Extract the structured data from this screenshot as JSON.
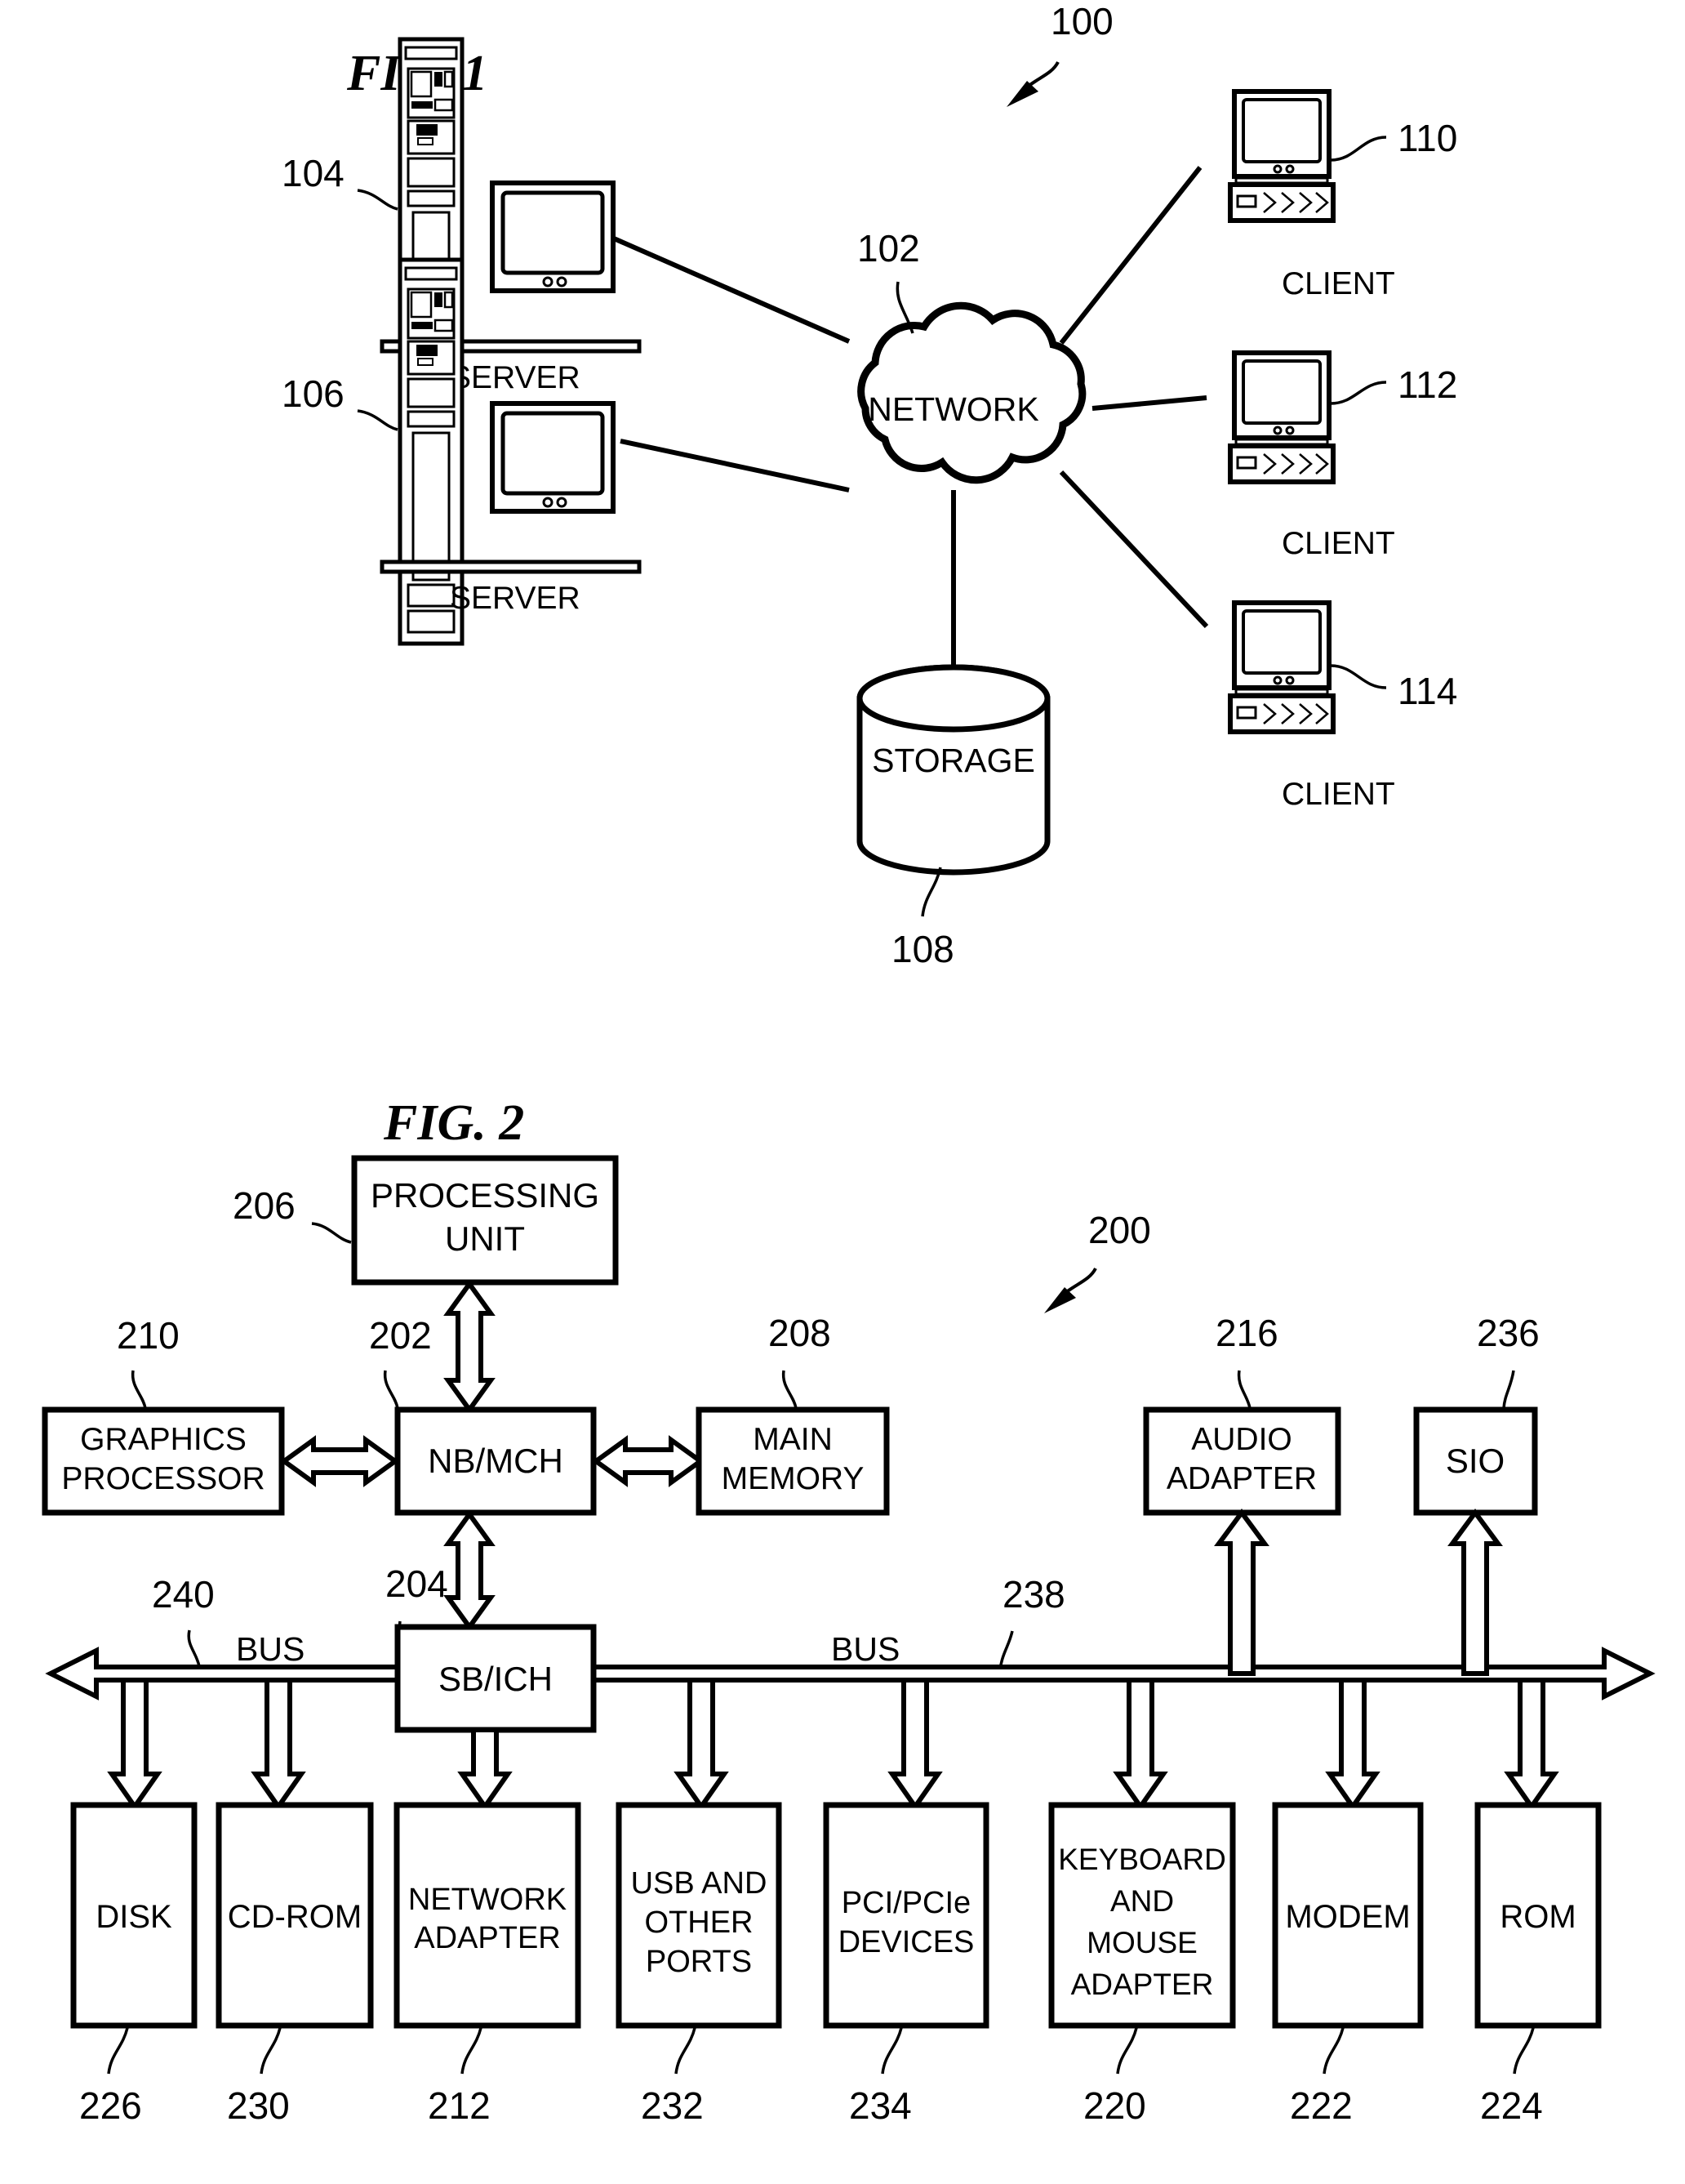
{
  "figures": [
    {
      "id": "fig1",
      "title": "FIG. 1",
      "overall_ref": "100",
      "nodes": [
        {
          "ref": "104",
          "label": "SERVER",
          "kind": "server"
        },
        {
          "ref": "106",
          "label": "SERVER",
          "kind": "server"
        },
        {
          "ref": "102",
          "label": "NETWORK",
          "kind": "cloud"
        },
        {
          "ref": "108",
          "label": "STORAGE",
          "kind": "cylinder"
        },
        {
          "ref": "110",
          "label": "CLIENT",
          "kind": "client"
        },
        {
          "ref": "112",
          "label": "CLIENT",
          "kind": "client"
        },
        {
          "ref": "114",
          "label": "CLIENT",
          "kind": "client"
        }
      ]
    },
    {
      "id": "fig2",
      "title": "FIG. 2",
      "overall_ref": "200",
      "nodes": [
        {
          "ref": "206",
          "label": "PROCESSING UNIT",
          "lines": [
            "PROCESSING",
            "UNIT"
          ]
        },
        {
          "ref": "210",
          "label": "GRAPHICS PROCESSOR",
          "lines": [
            "GRAPHICS",
            "PROCESSOR"
          ]
        },
        {
          "ref": "202",
          "label": "NB/MCH",
          "lines": [
            "NB/MCH"
          ]
        },
        {
          "ref": "208",
          "label": "MAIN MEMORY",
          "lines": [
            "MAIN",
            "MEMORY"
          ]
        },
        {
          "ref": "216",
          "label": "AUDIO ADAPTER",
          "lines": [
            "AUDIO",
            "ADAPTER"
          ]
        },
        {
          "ref": "236",
          "label": "SIO",
          "lines": [
            "SIO"
          ]
        },
        {
          "ref": "204",
          "label": "SB/ICH",
          "lines": [
            "SB/ICH"
          ]
        },
        {
          "ref": "226",
          "label": "DISK",
          "lines": [
            "DISK"
          ]
        },
        {
          "ref": "230",
          "label": "CD-ROM",
          "lines": [
            "CD-ROM"
          ]
        },
        {
          "ref": "212",
          "label": "NETWORK ADAPTER",
          "lines": [
            "NETWORK",
            "ADAPTER"
          ]
        },
        {
          "ref": "232",
          "label": "USB AND OTHER PORTS",
          "lines": [
            "USB AND",
            "OTHER",
            "PORTS"
          ]
        },
        {
          "ref": "234",
          "label": "PCI/PCIe DEVICES",
          "lines": [
            "PCI/PCIe",
            "DEVICES"
          ]
        },
        {
          "ref": "220",
          "label": "KEYBOARD AND MOUSE ADAPTER",
          "lines": [
            "KEYBOARD",
            "AND",
            "MOUSE",
            "ADAPTER"
          ]
        },
        {
          "ref": "222",
          "label": "MODEM",
          "lines": [
            "MODEM"
          ]
        },
        {
          "ref": "224",
          "label": "ROM",
          "lines": [
            "ROM"
          ]
        }
      ],
      "buses": [
        {
          "ref": "240",
          "label": "BUS"
        },
        {
          "ref": "238",
          "label": "BUS"
        }
      ]
    }
  ],
  "colors": {
    "ink": "#000000",
    "paper": "#ffffff"
  }
}
